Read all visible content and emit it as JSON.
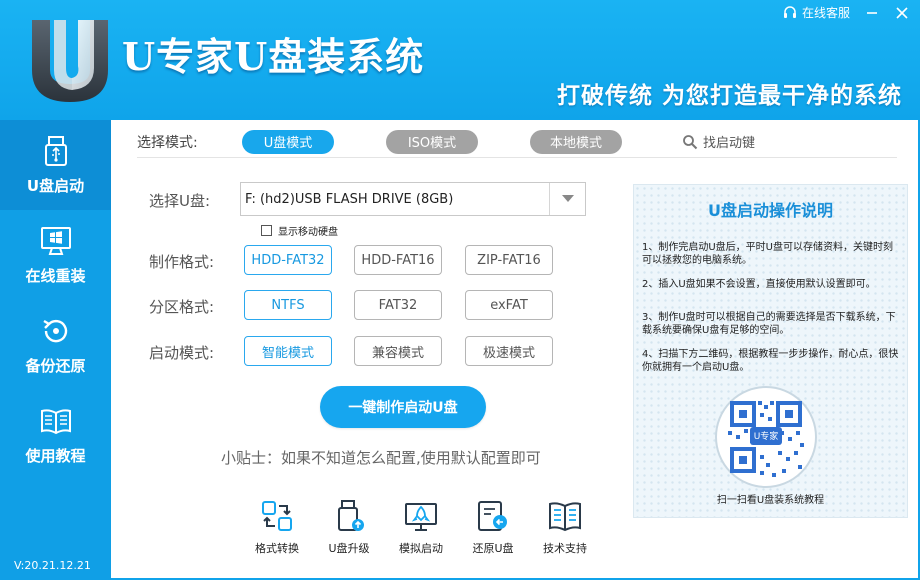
{
  "header": {
    "title": "U专家U盘装系统",
    "slogan": "打破传统   为您打造最干净的系统",
    "support_label": "在线客服"
  },
  "sidebar": {
    "items": [
      {
        "label": "U盘启动",
        "icon": "usb-drive-icon",
        "active": true
      },
      {
        "label": "在线重装",
        "icon": "windows-monitor-icon",
        "active": false
      },
      {
        "label": "备份还原",
        "icon": "backup-restore-icon",
        "active": false
      },
      {
        "label": "使用教程",
        "icon": "book-icon",
        "active": false
      }
    ],
    "version": "V:20.21.12.21"
  },
  "mode": {
    "label": "选择模式:",
    "tabs": [
      {
        "label": "U盘模式",
        "active": true
      },
      {
        "label": "ISO模式",
        "active": false
      },
      {
        "label": "本地模式",
        "active": false
      }
    ],
    "find_key": "找启动键"
  },
  "drive": {
    "label": "选择U盘:",
    "value": "F: (hd2)USB FLASH DRIVE (8GB)",
    "show_removable_hdd": "显示移动硬盘"
  },
  "format": {
    "label": "制作格式:",
    "options": [
      "HDD-FAT32",
      "HDD-FAT16",
      "ZIP-FAT16"
    ],
    "selected": "HDD-FAT32"
  },
  "partition": {
    "label": "分区格式:",
    "options": [
      "NTFS",
      "FAT32",
      "exFAT"
    ],
    "selected": "NTFS"
  },
  "boot": {
    "label": "启动模式:",
    "options": [
      "智能模式",
      "兼容模式",
      "极速模式"
    ],
    "selected": "智能模式"
  },
  "action": {
    "make_button": "一键制作启动U盘",
    "tip": "小贴士：如果不知道怎么配置,使用默认配置即可"
  },
  "tools": [
    {
      "label": "格式转换",
      "icon": "format-convert-icon"
    },
    {
      "label": "U盘升级",
      "icon": "usb-upgrade-icon"
    },
    {
      "label": "模拟启动",
      "icon": "simulate-boot-icon"
    },
    {
      "label": "还原U盘",
      "icon": "restore-usb-icon"
    },
    {
      "label": "技术支持",
      "icon": "tech-support-icon"
    }
  ],
  "guide": {
    "title": "U盘启动操作说明",
    "steps": [
      "1、制作完启动U盘后，平时U盘可以存储资料，关键时刻可以拯救您的电脑系统。",
      "2、插入U盘如果不会设置，直接使用默认设置即可。",
      "3、制作U盘时可以根据自己的需要选择是否下载系统，下载系统要确保U盘有足够的空间。",
      "4、扫描下方二维码，根据教程一步步操作，耐心点，很快你就拥有一个启动U盘。"
    ],
    "qr_label": "U专家",
    "qr_caption": "扫一扫看U盘装系统教程"
  },
  "colors": {
    "header": "#15ADF0",
    "sidebar": "#109FE6",
    "sidebar_active": "#0D8ED6",
    "accent": "#18A7EC",
    "tab_inactive": "#A3A3A3"
  }
}
